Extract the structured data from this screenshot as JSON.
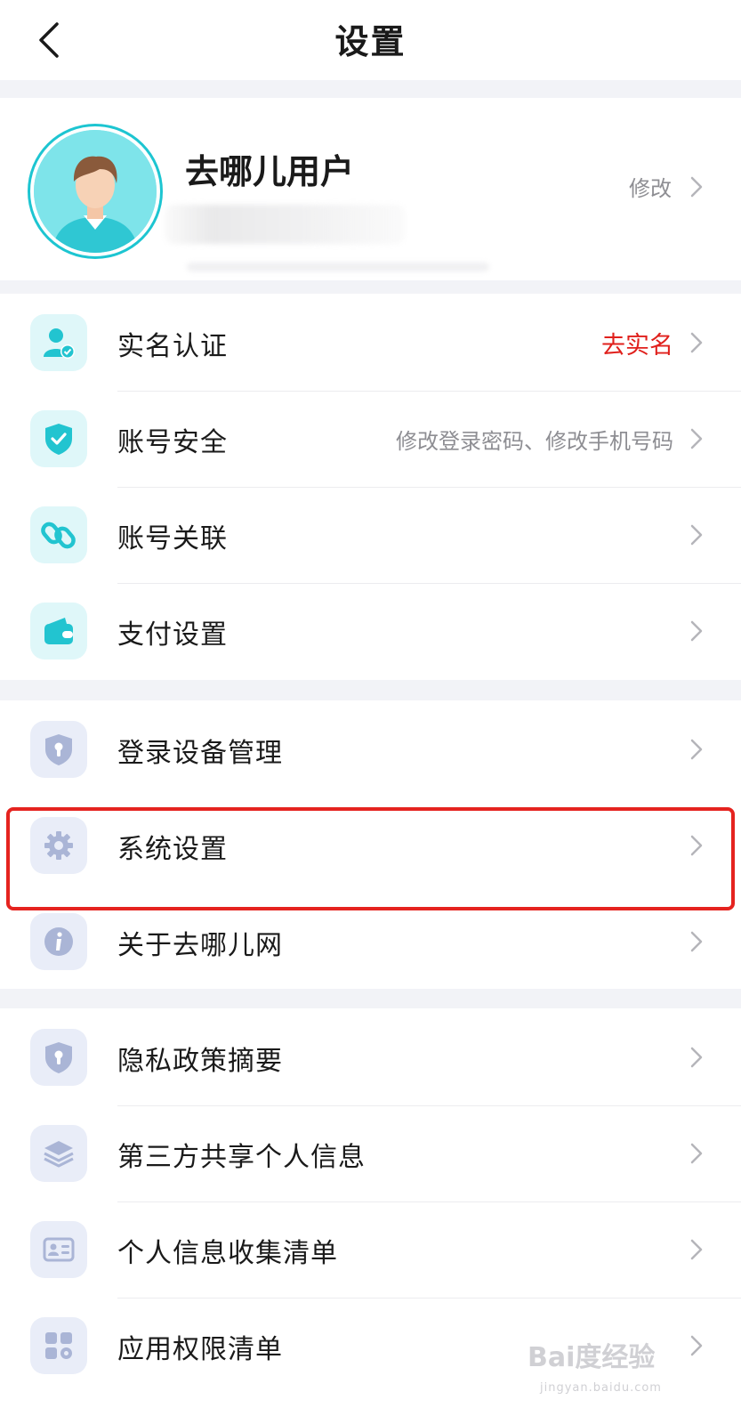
{
  "header": {
    "title": "设置"
  },
  "profile": {
    "username": "去哪儿用户",
    "edit_label": "修改"
  },
  "groups": [
    {
      "items": [
        {
          "label": "实名认证",
          "value": "去实名",
          "icon": "user-verified-icon"
        },
        {
          "label": "账号安全",
          "value": "修改登录密码、修改手机号码",
          "icon": "shield-check-icon"
        },
        {
          "label": "账号关联",
          "value": "",
          "icon": "link-icon"
        },
        {
          "label": "支付设置",
          "value": "",
          "icon": "wallet-icon"
        }
      ]
    },
    {
      "items": [
        {
          "label": "登录设备管理",
          "value": "",
          "icon": "lock-shield-icon"
        },
        {
          "label": "系统设置",
          "value": "",
          "icon": "gear-icon"
        },
        {
          "label": "关于去哪儿网",
          "value": "",
          "icon": "info-icon"
        }
      ]
    },
    {
      "items": [
        {
          "label": "隐私政策摘要",
          "value": "",
          "icon": "lock-shield-icon"
        },
        {
          "label": "第三方共享个人信息",
          "value": "",
          "icon": "layers-icon"
        },
        {
          "label": "个人信息收集清单",
          "value": "",
          "icon": "id-card-icon"
        },
        {
          "label": "应用权限清单",
          "value": "",
          "icon": "apps-grid-icon"
        }
      ]
    }
  ],
  "watermark": {
    "text": "Bai度经验",
    "sub": "jingyan.baidu.com"
  },
  "colors": {
    "accent_cyan": "#1dc5d1",
    "warning_red": "#e0201c",
    "highlight_red": "#e5231f",
    "icon_blue_gray": "#aab5d6"
  }
}
